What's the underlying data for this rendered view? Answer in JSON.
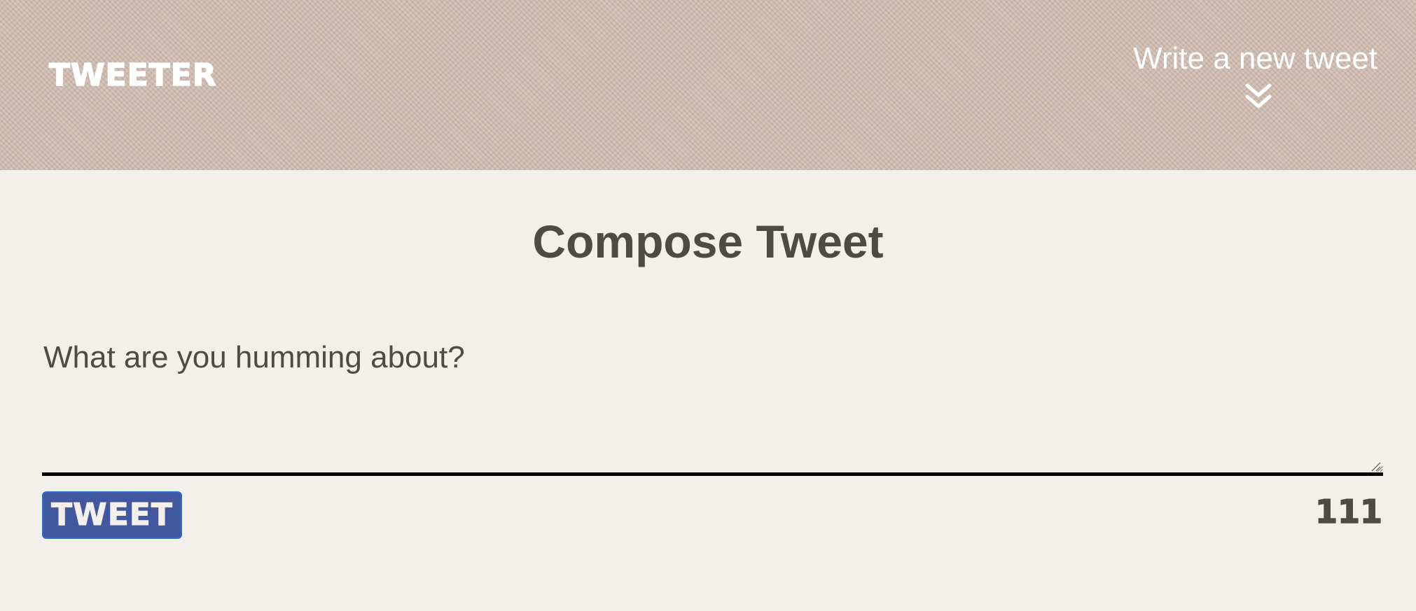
{
  "nav": {
    "logo": "TWEETER",
    "write_link": "Write a new tweet",
    "write_icon": "double-chevron-down-icon"
  },
  "compose": {
    "title": "Compose Tweet",
    "textarea_value": "",
    "textarea_placeholder": "What are you humming about?",
    "submit_label": "TWEET",
    "char_counter": "111"
  },
  "colors": {
    "nav_background": "#d0bdb2",
    "page_background": "#f3f0eb",
    "text": "#4f4a44",
    "button_background": "#4157a0",
    "button_border": "#2f6ec9",
    "nav_text": "#ffffff"
  }
}
